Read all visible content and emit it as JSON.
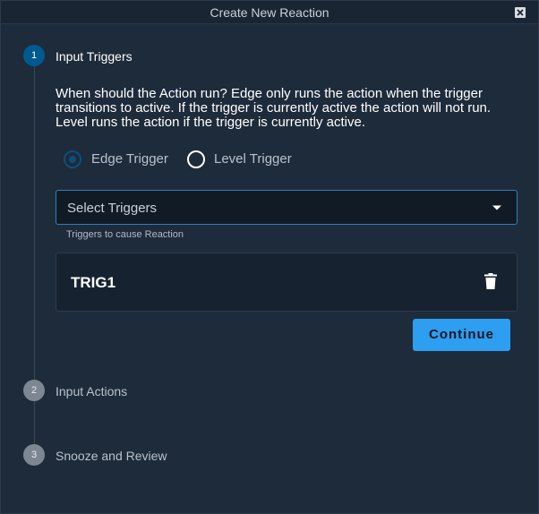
{
  "window": {
    "title": "Create New Reaction"
  },
  "steps": [
    {
      "number": "1",
      "label": "Input Triggers",
      "state": "active"
    },
    {
      "number": "2",
      "label": "Input Actions",
      "state": "inactive"
    },
    {
      "number": "3",
      "label": "Snooze and Review",
      "state": "inactive"
    }
  ],
  "step1": {
    "description": "When should the Action run? Edge only runs the action when the trigger transitions to active. If the trigger is currently active the action will not run. Level runs the action if the trigger is currently active.",
    "trigger_modes": [
      {
        "label": "Edge Trigger",
        "selected": true
      },
      {
        "label": "Level Trigger",
        "selected": false
      }
    ],
    "select": {
      "placeholder": "Select Triggers",
      "hint": "Triggers to cause Reaction"
    },
    "triggers": [
      {
        "name": "TRIG1"
      }
    ],
    "continue_label": "Continue"
  },
  "colors": {
    "accent": "#2d9ef0",
    "active_step": "#005a8e",
    "background": "#1e2b3b"
  }
}
